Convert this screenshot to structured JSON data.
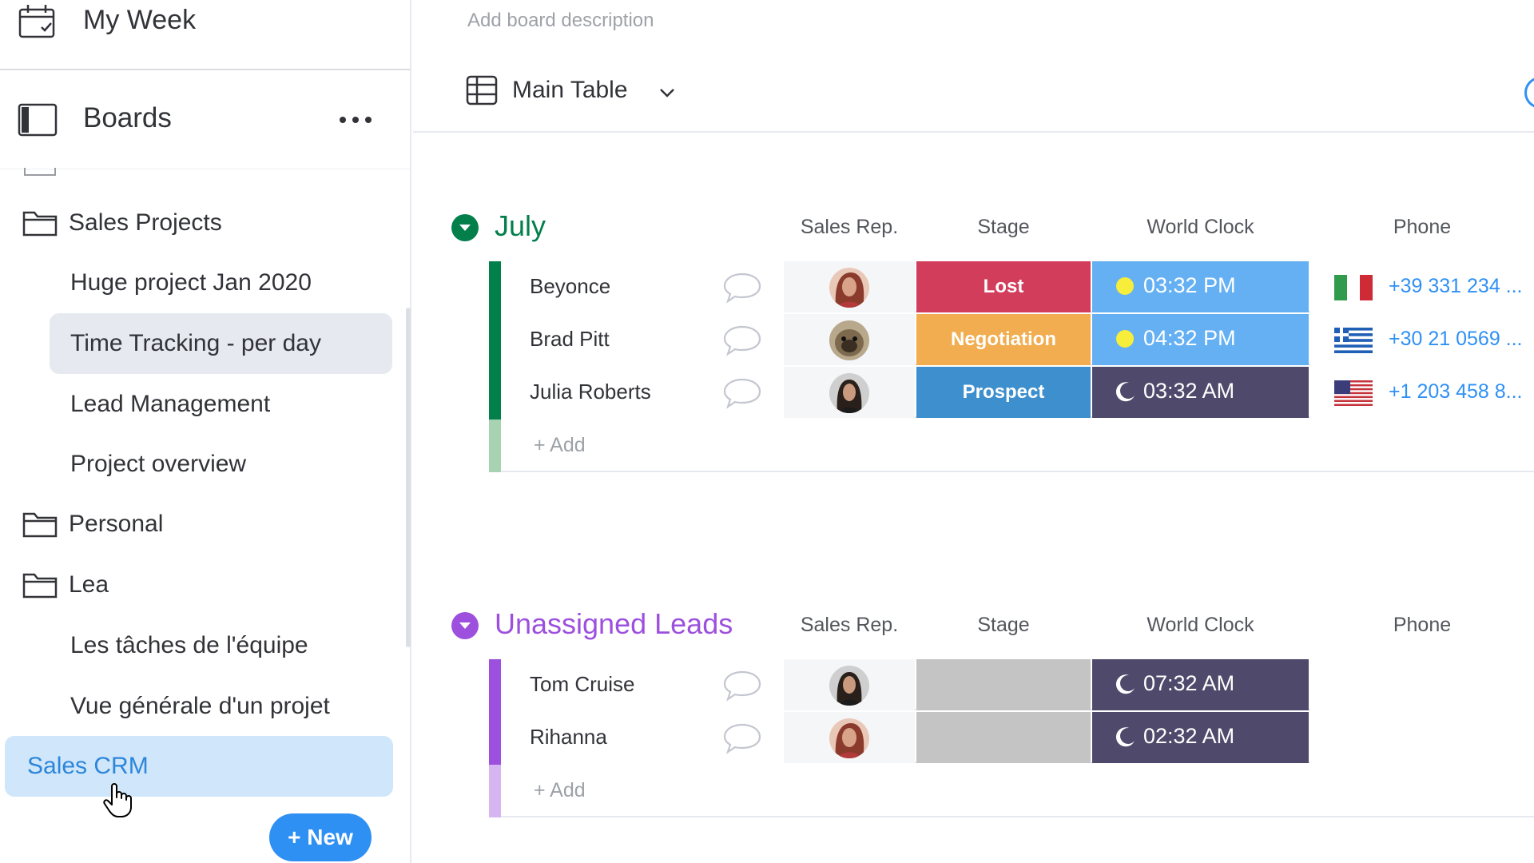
{
  "sidebar": {
    "my_week": "My Week",
    "boards_title": "Boards",
    "folders": [
      {
        "name": "Sales Projects",
        "items": [
          "Huge project Jan 2020",
          "Time Tracking - per day",
          "Lead Management",
          "Project overview"
        ]
      },
      {
        "name": "Personal",
        "items": []
      },
      {
        "name": "Lea",
        "items": [
          "Les tâches de l'équipe",
          "Vue générale d'un projet"
        ]
      }
    ],
    "selected_board": "Sales CRM",
    "active_board": "Time Tracking - per day",
    "new_button": "+ New"
  },
  "board": {
    "description_placeholder": "Add board description",
    "view_name": "Main Table"
  },
  "columns": {
    "sales_rep": "Sales Rep.",
    "stage": "Stage",
    "world_clock": "World Clock",
    "phone": "Phone"
  },
  "groups": [
    {
      "title": "July",
      "color": "#037f4c",
      "rows": [
        {
          "name": "Beyonce",
          "stage": "Lost",
          "stage_color": "#d23d5c",
          "time": "03:32 PM",
          "period": "day",
          "flag": "italy",
          "phone": "+39 331 234 ..."
        },
        {
          "name": "Brad Pitt",
          "stage": "Negotiation",
          "stage_color": "#f1ad4f",
          "time": "04:32 PM",
          "period": "day",
          "flag": "greece",
          "phone": "+30 21 0569 ..."
        },
        {
          "name": "Julia Roberts",
          "stage": "Prospect",
          "stage_color": "#3d8fcd",
          "time": "03:32 AM",
          "period": "night",
          "flag": "usa",
          "phone": "+1 203 458 8..."
        }
      ],
      "add_label": "+ Add"
    },
    {
      "title": "Unassigned Leads",
      "color": "#9d50dd",
      "rows": [
        {
          "name": "Tom Cruise",
          "stage": "",
          "stage_color": "#c4c4c4",
          "time": "07:32 AM",
          "period": "night"
        },
        {
          "name": "Rihanna",
          "stage": "",
          "stage_color": "#c4c4c4",
          "time": "02:32 AM",
          "period": "night"
        }
      ],
      "add_label": "+ Add"
    }
  ],
  "colors": {
    "clock_day": "#64b0f3",
    "clock_night": "#4f4a6b",
    "primary": "#2f90f4"
  }
}
